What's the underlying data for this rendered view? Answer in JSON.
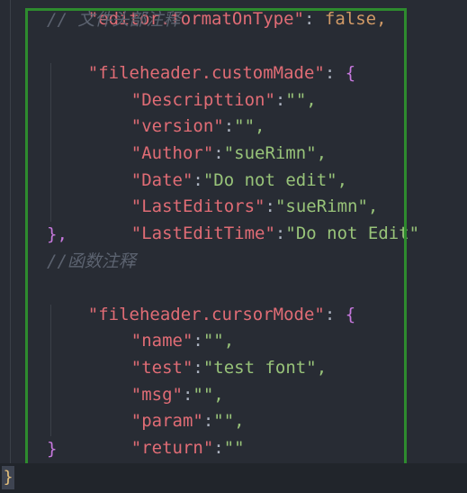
{
  "editor": {
    "top_partial": {
      "key": "\"editor.formatOnType\"",
      "value": "false,"
    },
    "comment1": "// 文件头部注释",
    "custom_made": {
      "key": "\"fileheader.customMade\"",
      "colon": ": ",
      "open": "{",
      "entries": [
        {
          "key": "\"Descripttion\"",
          "value": "\"\","
        },
        {
          "key": "\"version\"",
          "value": "\"\","
        },
        {
          "key": "\"Author\"",
          "value": "\"sueRimn\","
        },
        {
          "key": "\"Date\"",
          "value": "\"Do not edit\","
        },
        {
          "key": "\"LastEditors\"",
          "value": "\"sueRimn\","
        },
        {
          "key": "\"LastEditTime\"",
          "value": "\"Do not Edit\""
        }
      ],
      "close": "},"
    },
    "comment2": "//函数注释",
    "cursor_mode": {
      "key": "\"fileheader.cursorMode\"",
      "colon": ": ",
      "open": "{",
      "entries": [
        {
          "key": "\"name\"",
          "value": "\"\","
        },
        {
          "key": "\"test\"",
          "value": "\"test font\","
        },
        {
          "key": "\"msg\"",
          "value": "\"\","
        },
        {
          "key": "\"param\"",
          "value": "\"\","
        },
        {
          "key": "\"return\"",
          "value": "\"\""
        }
      ],
      "close": "}"
    },
    "final_brace": "}"
  },
  "colors": {
    "background": "#282c34",
    "key": "#e06c75",
    "string": "#98c379",
    "brace": "#c678dd",
    "comment": "#5c6370",
    "highlight_border": "#2e8b2e"
  }
}
